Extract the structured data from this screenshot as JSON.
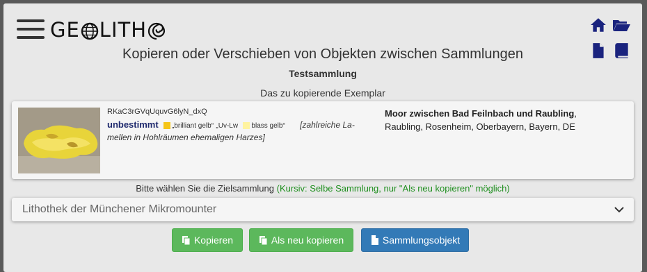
{
  "app": {
    "logo_prefix": "GE",
    "logo_middle": "LITH",
    "logo_icons": [
      "globe-icon",
      "ammonite-icon"
    ]
  },
  "header": {
    "icons": [
      "home-icon",
      "folder-open-icon",
      "document-icon",
      "book-icon"
    ]
  },
  "page": {
    "title": "Kopieren oder Verschieben von Objekten zwischen Sammlungen",
    "collection": "Testsammlung",
    "section_label": "Das zu kopierende Exemplar"
  },
  "specimen": {
    "id": "RKaC3rGVqUquvG6lyN_dxQ",
    "mineral": "unbestimmt",
    "colors": [
      {
        "label": "„brilliant gelb“",
        "hex": "#f5c518"
      },
      {
        "label": "„Uv-Lw",
        "hex": ""
      },
      {
        "label": "blass gelb“",
        "hex": "#fff3a0"
      }
    ],
    "remark": "[zahlreiche Lamellen in Hohlräumen ehemaligen Harzes]",
    "remark_part1": "[zahlreiche La-",
    "remark_part2": "mellen in Hohlräumen ehemaligen Harzes]",
    "locality_name": "Moor zwischen Bad Feilnbach und Raubling",
    "locality_sep": ",",
    "locality_region": "Raubling, Rosenheim, Oberbayern, Bayern, DE"
  },
  "target": {
    "label": "Bitte wählen Sie die Zielsammlung",
    "hint": "(Kursiv: Selbe Sammlung, nur \"Als neu kopieren\" möglich)",
    "selected": "Lithothek der Münchener Mikromounter"
  },
  "buttons": {
    "copy": "Kopieren",
    "copy_new": "Als neu kopieren",
    "collection_object": "Sammlungsobjekt"
  },
  "colors": {
    "green": "#5cb85c",
    "blue": "#337ab7",
    "navy": "#1f2a6e",
    "hint": "#1f8f1f"
  }
}
